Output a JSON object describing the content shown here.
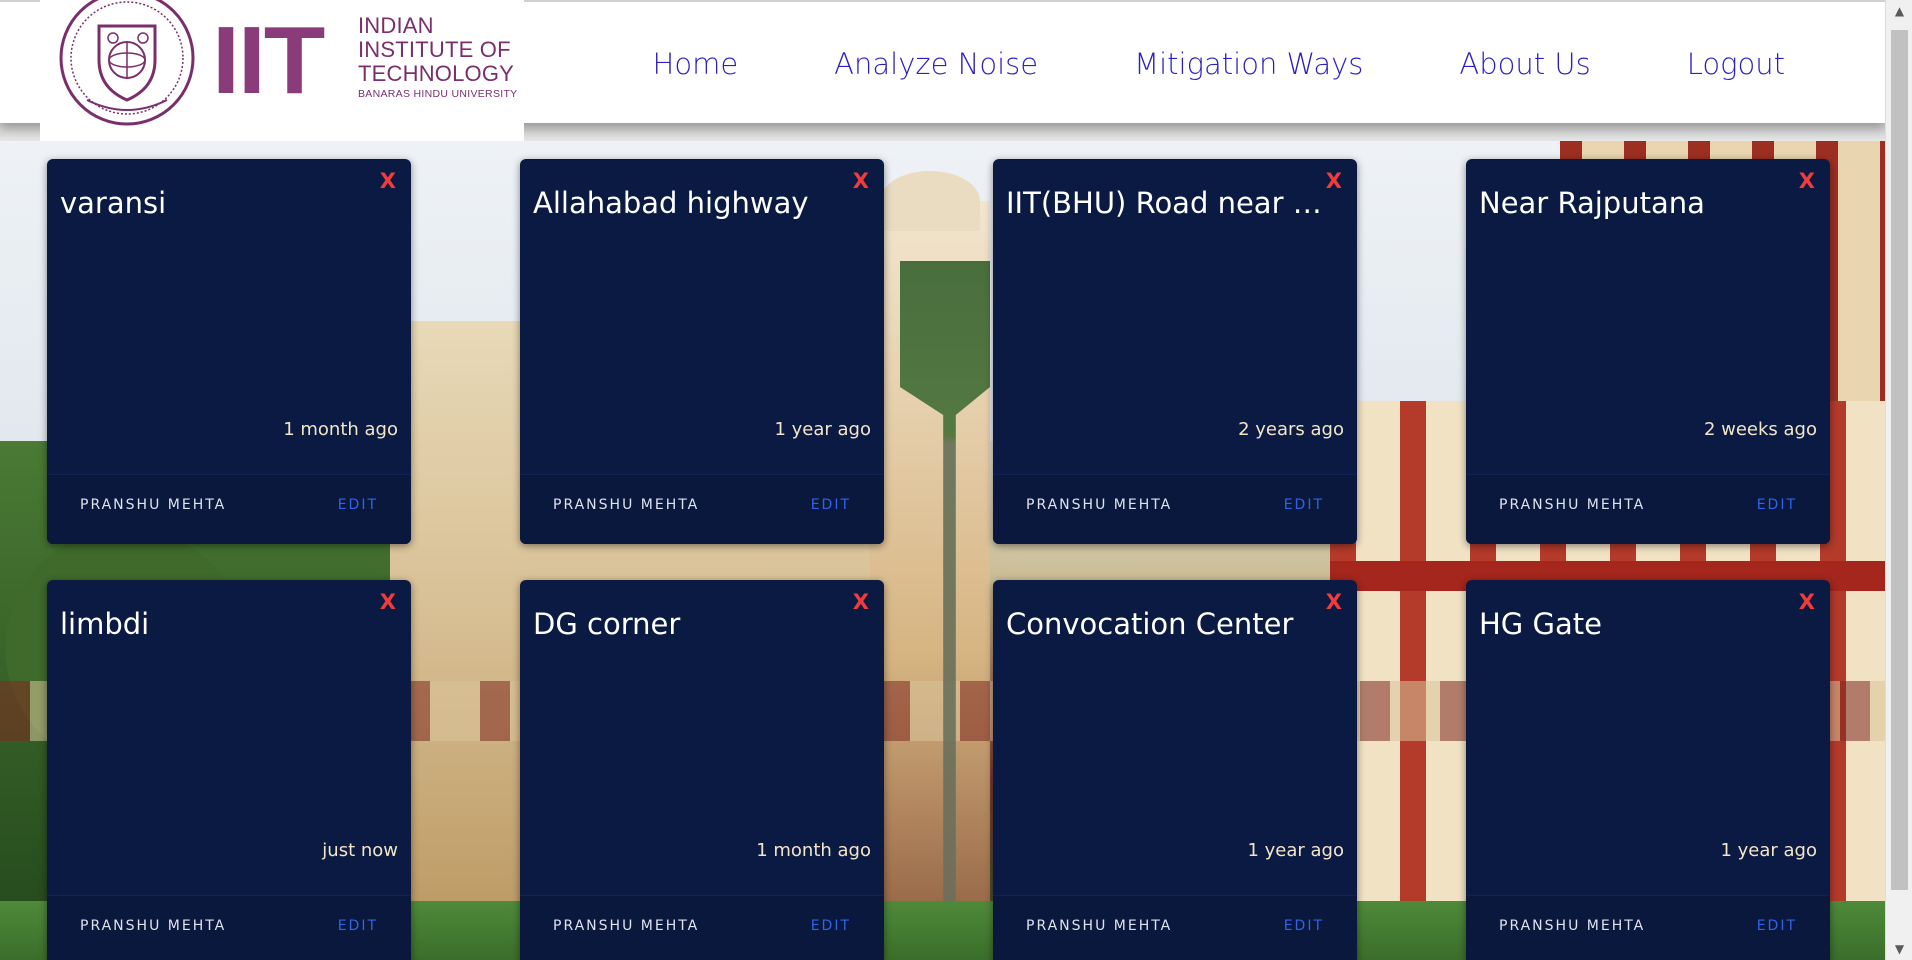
{
  "header": {
    "logo_mark": "IIT",
    "institute_line1": "INDIAN",
    "institute_line2": "INSTITUTE OF",
    "institute_line3": "TECHNOLOGY",
    "institute_sub": "BANARAS HINDU UNIVERSITY",
    "emblem_icon": "iit-bhu-emblem-icon"
  },
  "nav": {
    "items": [
      {
        "label": "Home"
      },
      {
        "label": "Analyze Noise"
      },
      {
        "label": "Mitigation Ways"
      },
      {
        "label": "About Us"
      },
      {
        "label": "Logout"
      }
    ],
    "color": "#2d1fc6"
  },
  "cards": [
    {
      "title": "varansi",
      "time": "1 month ago",
      "author": "PRANSHU MEHTA",
      "edit": "EDIT",
      "close": "X"
    },
    {
      "title": "Allahabad highway",
      "time": "1 year ago",
      "author": "PRANSHU MEHTA",
      "edit": "EDIT",
      "close": "X"
    },
    {
      "title": "IIT(BHU) Road near the...",
      "time": "2 years ago",
      "author": "PRANSHU MEHTA",
      "edit": "EDIT",
      "close": "X"
    },
    {
      "title": "Near Rajputana",
      "time": "2 weeks ago",
      "author": "PRANSHU MEHTA",
      "edit": "EDIT",
      "close": "X"
    },
    {
      "title": "limbdi",
      "time": "just now",
      "author": "PRANSHU MEHTA",
      "edit": "EDIT",
      "close": "X"
    },
    {
      "title": "DG corner",
      "time": "1 month ago",
      "author": "PRANSHU MEHTA",
      "edit": "EDIT",
      "close": "X"
    },
    {
      "title": "Convocation Center",
      "time": "1 year ago",
      "author": "PRANSHU MEHTA",
      "edit": "EDIT",
      "close": "X"
    },
    {
      "title": "HG Gate",
      "time": "1 year ago",
      "author": "PRANSHU MEHTA",
      "edit": "EDIT",
      "close": "X"
    }
  ],
  "colors": {
    "card_bg": "#0b1a43",
    "close": "#f23b3b",
    "edit": "#2f63e8",
    "time": "#f3e6c8",
    "brand": "#8a3b79"
  }
}
